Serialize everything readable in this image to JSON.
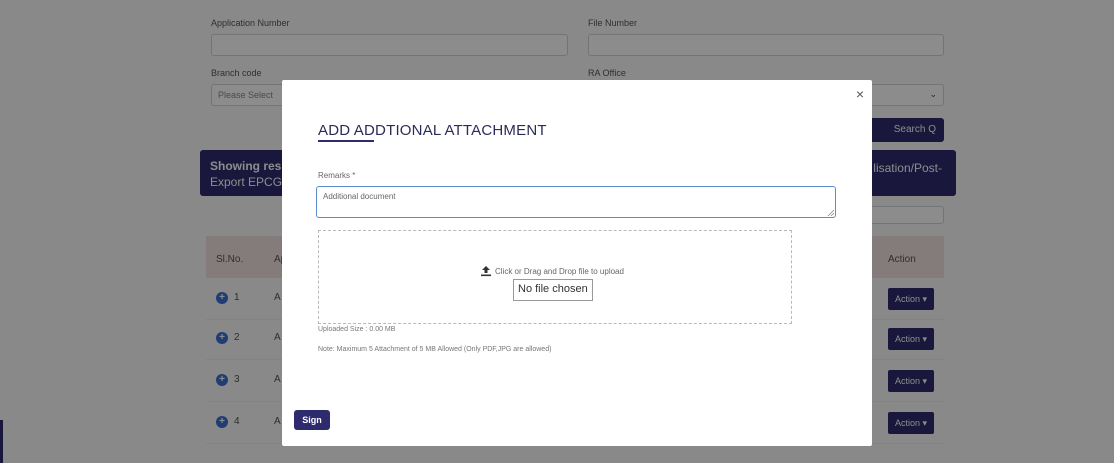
{
  "background": {
    "labels": {
      "application_number": "Application Number",
      "file_number": "File Number",
      "branch_code": "Branch code",
      "ra_office": "RA Office"
    },
    "branch_select_placeholder": "Please Select",
    "search_button": "Search Q",
    "banner": {
      "left_line1": "Showing resu",
      "left_line2": "Export EPCG A",
      "right_text": "lisation/Post-"
    },
    "table": {
      "headers": [
        "Sl.No.",
        "Ap",
        "Action"
      ],
      "rows": [
        {
          "num": "1",
          "a": "A",
          "action": "Action ▾"
        },
        {
          "num": "2",
          "a": "A",
          "action": "Action ▾"
        },
        {
          "num": "3",
          "a": "A",
          "action": "Action ▾"
        },
        {
          "num": "4",
          "a": "A",
          "action": "Action ▾"
        }
      ]
    }
  },
  "modal": {
    "close_symbol": "×",
    "title": "ADD ADDTIONAL ATTACHMENT",
    "remarks_label": "Remarks *",
    "remarks_value": "Additional document",
    "upload_prompt": "Click or Drag and Drop file to upload",
    "no_file_chosen": "No file chosen",
    "uploaded_size": "Uploaded Size : 0.00  MB",
    "note": "Note: Maximum 5 Attachment of 5 MB Allowed (Only PDF,JPG are allowed)",
    "sign_button": "Sign"
  },
  "colors": {
    "primary": "#2e2a6e",
    "input_focus": "#5b8ccf",
    "overlay": "rgba(0,0,0,0.45)"
  }
}
